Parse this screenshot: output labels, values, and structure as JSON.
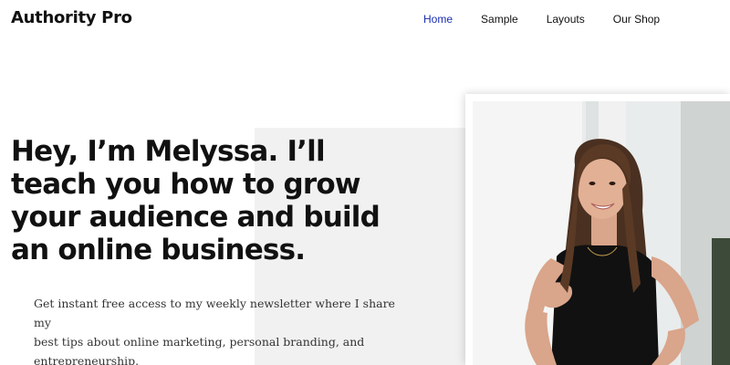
{
  "header": {
    "logo": "Authority Pro",
    "nav": [
      {
        "label": "Home",
        "active": true
      },
      {
        "label": "Sample",
        "active": false
      },
      {
        "label": "Layouts",
        "active": false
      },
      {
        "label": "Our Shop",
        "active": false
      }
    ]
  },
  "hero": {
    "headline_lines": [
      "Hey, I’m Melyssa. I’ll",
      "teach you how to grow",
      "your audience and build",
      "an online business."
    ],
    "intro_lines": [
      "Get instant free access to my weekly newsletter where I share my",
      "best tips about online marketing, personal branding, and",
      "entrepreneurship."
    ],
    "photo": "portrait-photo"
  },
  "colors": {
    "nav_active": "#1b2db0",
    "panel_gray": "#f1f1f1",
    "text_dark": "#111111"
  }
}
